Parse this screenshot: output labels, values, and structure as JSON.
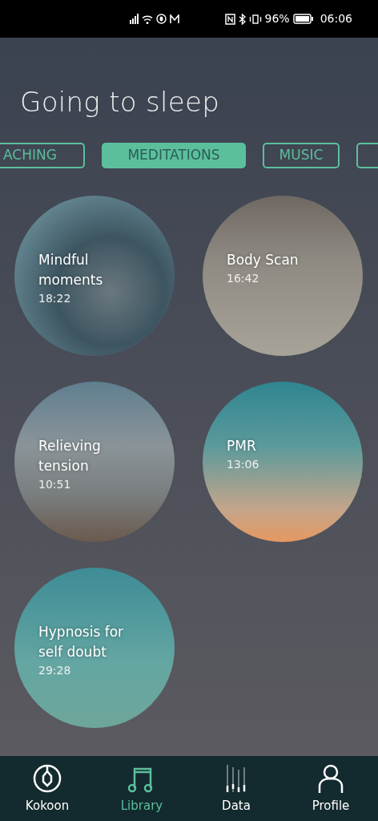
{
  "status_bar": {
    "battery": "96%",
    "time": "06:06"
  },
  "title": "Going to sleep",
  "tabs": [
    {
      "label": "ACHING",
      "selected": false
    },
    {
      "label": "MEDITATIONS",
      "selected": true
    },
    {
      "label": "MUSIC",
      "selected": false
    }
  ],
  "sessions": [
    {
      "title": "Mindful moments",
      "duration": "18:22"
    },
    {
      "title": "Body Scan",
      "duration": "16:42"
    },
    {
      "title": "Relieving tension",
      "duration": "10:51"
    },
    {
      "title": "PMR",
      "duration": "13:06"
    },
    {
      "title": "Hypnosis for self doubt",
      "duration": "29:28"
    }
  ],
  "nav": [
    {
      "label": "Kokoon",
      "kind": "logo",
      "selected": false
    },
    {
      "label": "Library",
      "kind": "music",
      "selected": true
    },
    {
      "label": "Data",
      "kind": "bars",
      "selected": false
    },
    {
      "label": "Profile",
      "kind": "person",
      "selected": false
    }
  ]
}
